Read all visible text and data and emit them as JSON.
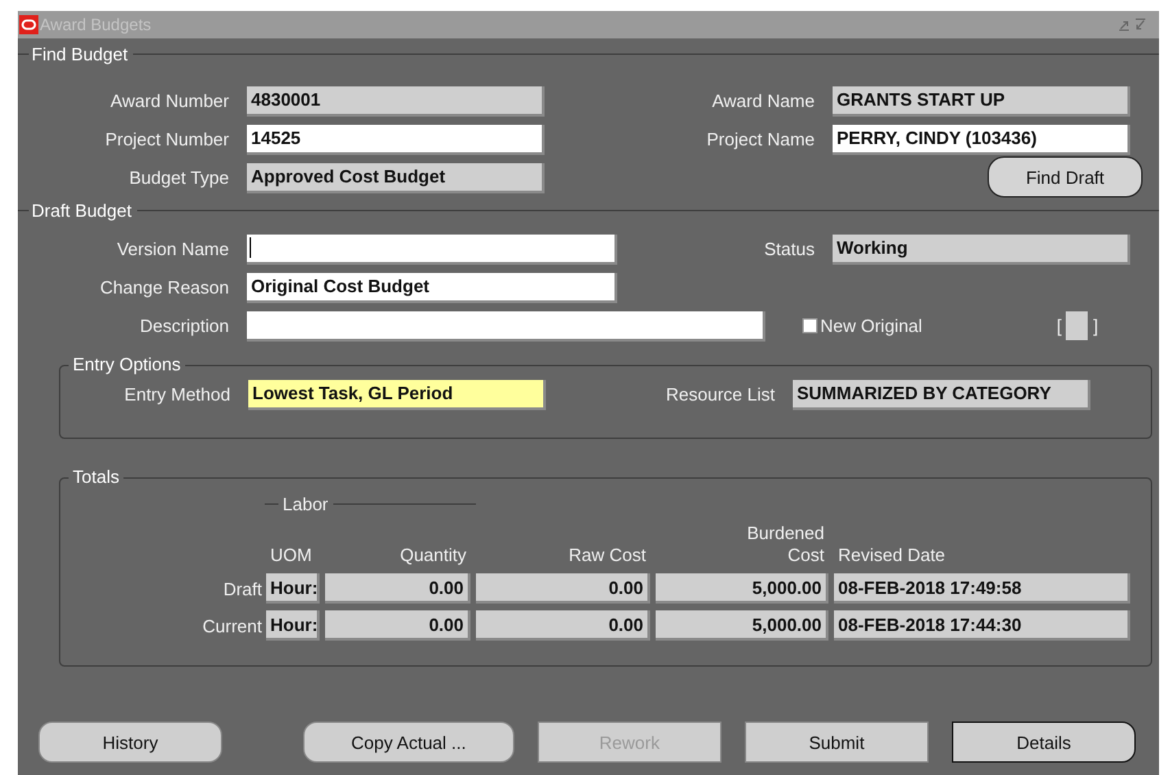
{
  "window": {
    "title": "Award Budgets"
  },
  "find_budget": {
    "legend": "Find Budget",
    "fields": [
      {
        "label": "Award Number",
        "value": "4830001",
        "kind": "readonly"
      },
      {
        "label": "Award Name",
        "value": "GRANTS START UP",
        "kind": "readonly"
      },
      {
        "label": "Project Number",
        "value": "14525",
        "kind": "editable"
      },
      {
        "label": "Project Name",
        "value": "PERRY, CINDY (103436)",
        "kind": "editable"
      },
      {
        "label": "Budget Type",
        "value": "Approved Cost Budget",
        "kind": "readonly"
      }
    ],
    "find_button": "Find Draft"
  },
  "draft_budget": {
    "legend": "Draft Budget",
    "version_name": {
      "label": "Version Name"
    },
    "status": {
      "label": "Status",
      "value": "Working"
    },
    "change_reason": {
      "label": "Change Reason",
      "value": "Original Cost Budget"
    },
    "description": {
      "label": "Description"
    },
    "new_original": {
      "label": "New Original",
      "checked": false
    },
    "bracket_left": "[",
    "bracket_right": "]"
  },
  "entry_options": {
    "legend": "Entry Options",
    "entry_method": {
      "label": "Entry Method",
      "value": "Lowest Task, GL Period",
      "kind": "required"
    },
    "resource_list": {
      "label": "Resource List",
      "value": "SUMMARIZED BY CATEGORY",
      "kind": "readonly"
    }
  },
  "totals": {
    "legend": "Totals",
    "group": "Labor",
    "burdened": "Burdened",
    "columns": [
      "UOM",
      "Quantity",
      "Raw Cost",
      "Cost",
      "Revised Date"
    ],
    "rows": [
      {
        "label": "Draft",
        "cells": [
          "Hour:",
          "0.00",
          "0.00",
          "5,000.00",
          "08-FEB-2018 17:49:58"
        ]
      },
      {
        "label": "Current",
        "cells": [
          "Hour:",
          "0.00",
          "0.00",
          "5,000.00",
          "08-FEB-2018 17:44:30"
        ]
      }
    ]
  },
  "buttons": [
    {
      "label": "History",
      "disabled": false,
      "kind": "rounded"
    },
    {
      "label": "Copy Actual ...",
      "disabled": false,
      "kind": "rounded"
    },
    {
      "label": "Rework",
      "disabled": true,
      "kind": "square"
    },
    {
      "label": "Submit",
      "disabled": false,
      "kind": "square"
    },
    {
      "label": "Details",
      "disabled": false,
      "kind": "default"
    }
  ]
}
